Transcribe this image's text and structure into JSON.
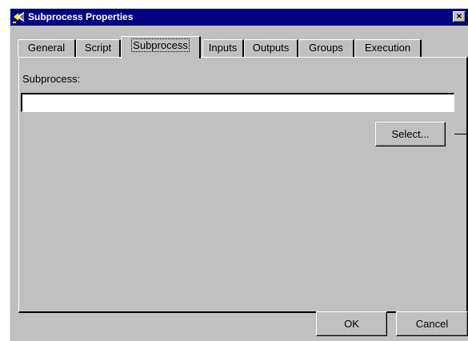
{
  "window": {
    "title": "Subprocess Properties",
    "close_label": "×"
  },
  "tabs": [
    {
      "label": "General",
      "active": false
    },
    {
      "label": "Script",
      "active": false
    },
    {
      "label": "Subprocess",
      "active": true
    },
    {
      "label": "Inputs",
      "active": false
    },
    {
      "label": "Outputs",
      "active": false
    },
    {
      "label": "Groups",
      "active": false
    },
    {
      "label": "Execution",
      "active": false
    }
  ],
  "subprocess": {
    "label": "Subprocess:",
    "value": "",
    "select_label": "Select..."
  },
  "footer": {
    "ok_label": "OK",
    "cancel_label": "Cancel"
  },
  "icons": {
    "app": "workflow-arrow-icon",
    "close": "close-icon"
  },
  "colors": {
    "title_bar": "#000080",
    "face": "#c0c0c0"
  }
}
